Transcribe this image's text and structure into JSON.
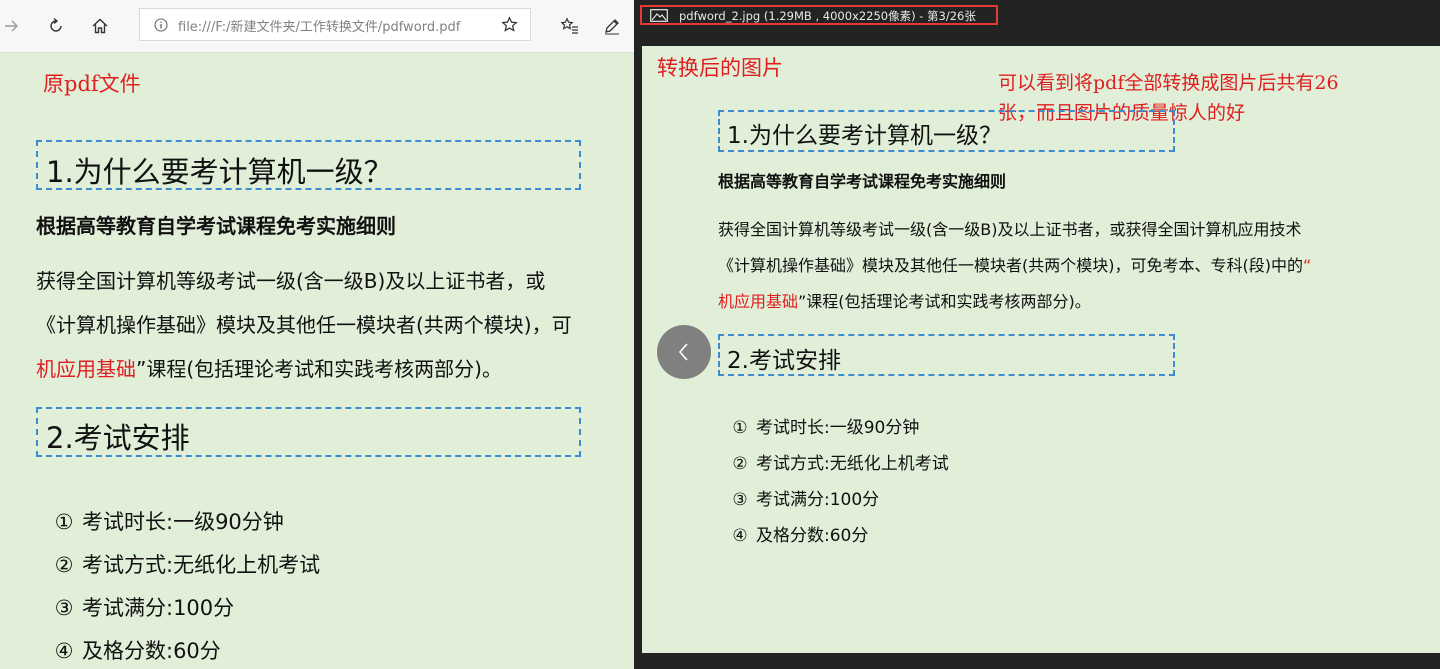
{
  "browser": {
    "address": "file:///F:/新建文件夹/工作转换文件/pdfword.pdf",
    "note": "原pdf文件"
  },
  "viewer": {
    "title": "pdfword_2.jpg (1.29MB , 4000x2250像素) - 第3/26张",
    "note": "转换后的图片",
    "annotation_line1": "可以看到将pdf全部转换成图片后共有26",
    "annotation_line2": "张，而且图片的质量惊人的好"
  },
  "doc": {
    "heading1": "1.为什么要考计算机一级？",
    "subheading": "根据高等教育自学考试课程免考实施细则",
    "para_line1_left": "获得全国计算机等级考试一级(含一级B)及以上证书者，或",
    "para_line1_right": "获得全国计算机等级考试一级(含一级B)及以上证书者，或获得全国计算机应用技术",
    "para_line2_left": "《计算机操作基础》模块及其他任一模块者(共两个模块)，可",
    "para_line2_right": "《计算机操作基础》模块及其他任一模块者(共两个模块)，可免考本、专科(段)中的",
    "para_line2_right_red": "“",
    "para_line3_red": "机应用基础",
    "para_line3_rest": "”课程(包括理论考试和实践考核两部分)。",
    "heading2": "2.考试安排",
    "list": [
      {
        "num": "①",
        "text": "考试时长:一级90分钟"
      },
      {
        "num": "②",
        "text": "考试方式:无纸化上机考试"
      },
      {
        "num": "③",
        "text": "考试满分:100分"
      },
      {
        "num": "④",
        "text": "及格分数:60分"
      }
    ]
  },
  "icons": {
    "back": "back-arrow-icon",
    "refresh": "refresh-icon",
    "home": "home-icon",
    "info": "info-icon",
    "star": "star-icon",
    "favorites": "favorites-list-icon",
    "pen": "pen-icon",
    "image": "image-icon",
    "prev": "chevron-left-icon"
  },
  "colors": {
    "page_bg": "#e1efd9",
    "red_note": "#e02020",
    "heading_box": "#3f8bd1",
    "viewer_bg": "#232323",
    "title_border": "#e53935"
  }
}
